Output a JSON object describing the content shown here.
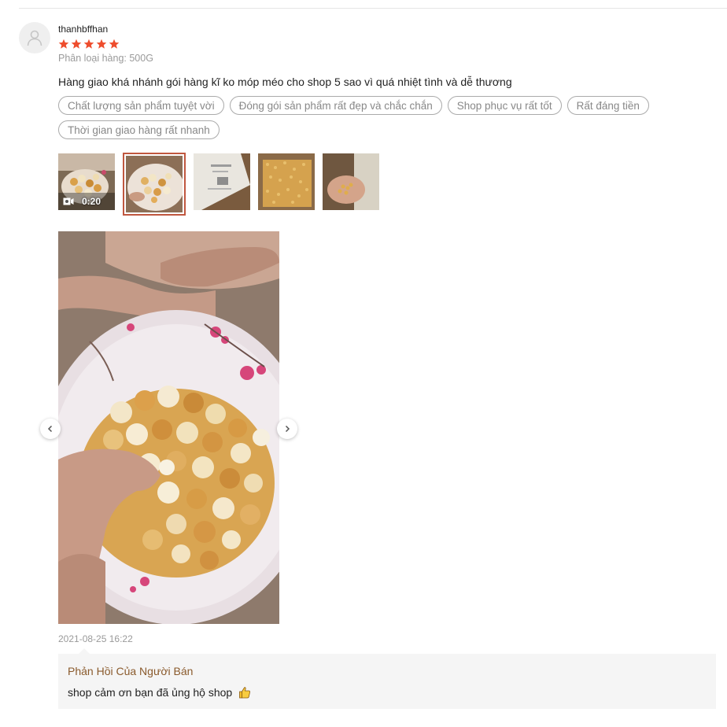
{
  "review": {
    "username": "thanhbffhan",
    "rating": 5,
    "star_color": "#ee4d2d",
    "variant": "Phân loại hàng: 500G",
    "comment": "Hàng giao khá nhánh gói hàng kĩ ko móp méo cho shop 5 sao vì quá nhiệt tình và dễ thương",
    "tags": [
      "Chất lượng sản phẩm tuyệt vời",
      "Đóng gói sản phẩm rất đẹp và chắc chắn",
      "Shop phục vụ rất tốt",
      "Rất đáng tiền",
      "Thời gian giao hàng rất nhanh"
    ],
    "media": {
      "video_duration": "0:20",
      "thumbnails": [
        "video-thumbnail",
        "popcorn-bowl",
        "package-box",
        "corn-kernels-box",
        "kernels-in-hand"
      ],
      "selected_index": 1
    },
    "timestamp": "2021-08-25 16:22",
    "seller_reply": {
      "title": "Phản Hồi Của Người Bán",
      "text": "shop cảm ơn bạn đã ủng hộ shop"
    }
  }
}
